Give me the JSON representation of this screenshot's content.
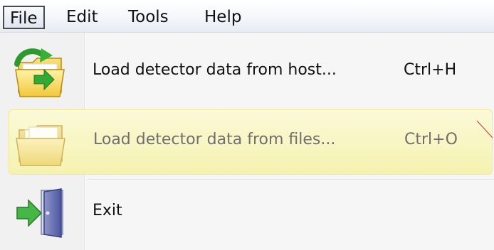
{
  "menubar": {
    "items": [
      {
        "label": "File"
      },
      {
        "label": "Edit"
      },
      {
        "label": "Tools"
      },
      {
        "label": "Help"
      }
    ]
  },
  "file_menu": {
    "items": [
      {
        "label": "Load detector data from host...",
        "shortcut": "Ctrl+H",
        "icon": "folder-load-host-icon",
        "state": "enabled"
      },
      {
        "label": "Load detector data from files...",
        "shortcut": "Ctrl+O",
        "icon": "folder-open-icon",
        "state": "highlighted"
      },
      {
        "label": "Exit",
        "shortcut": "",
        "icon": "exit-door-icon",
        "state": "enabled"
      }
    ]
  },
  "colors": {
    "highlight": "#f5f2b0",
    "annotation": "#e04040"
  }
}
